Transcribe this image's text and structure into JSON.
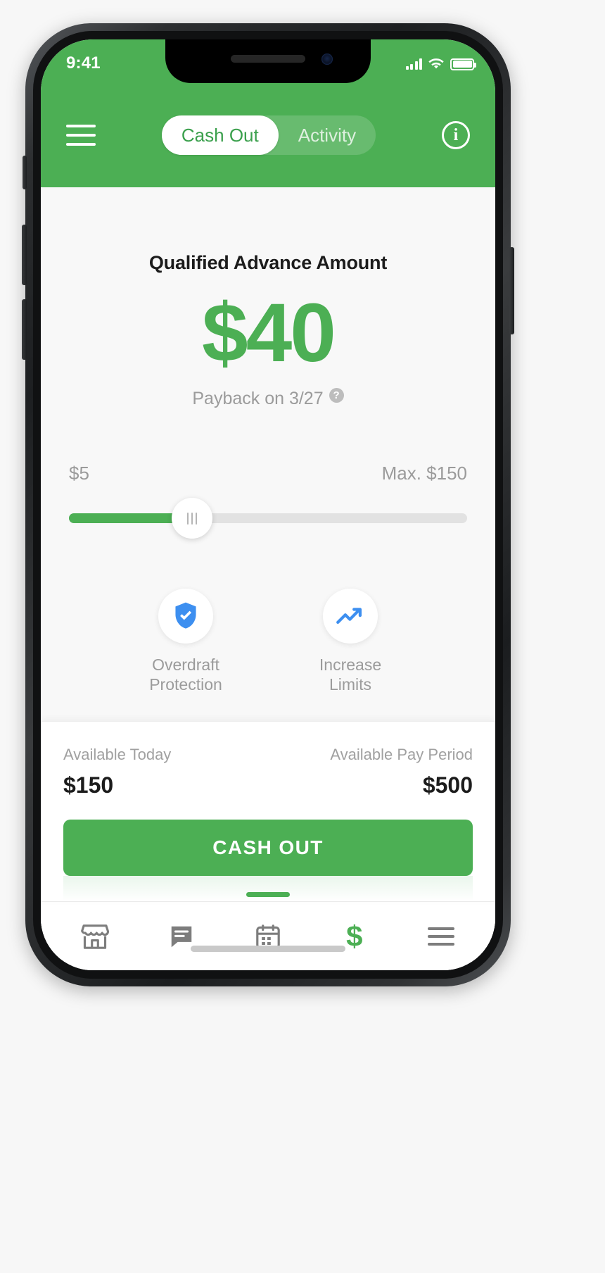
{
  "status_bar": {
    "time": "9:41",
    "icons": [
      "cellular-signal-icon",
      "wifi-icon",
      "battery-icon"
    ]
  },
  "header": {
    "menu_icon": "hamburger-menu-icon",
    "tabs": [
      {
        "label": "Cash Out",
        "active": true
      },
      {
        "label": "Activity",
        "active": false
      }
    ],
    "info_icon_label": "i"
  },
  "advance": {
    "title": "Qualified Advance Amount",
    "amount": "$40",
    "payback_text": "Payback on 3/27",
    "help_icon_label": "?"
  },
  "slider": {
    "min_label": "$5",
    "max_label": "Max. $150",
    "fill_percent": 31
  },
  "quick_actions": [
    {
      "icon": "shield-check-icon",
      "line1": "Overdraft",
      "line2": "Protection"
    },
    {
      "icon": "trending-up-icon",
      "line1": "Increase",
      "line2": "Limits"
    }
  ],
  "balances": {
    "today_label": "Available Today",
    "today_value": "$150",
    "period_label": "Available Pay Period",
    "period_value": "$500"
  },
  "cash_out_button": "CASH OUT",
  "tab_bar": [
    {
      "name": "store-icon"
    },
    {
      "name": "chat-icon"
    },
    {
      "name": "calendar-icon"
    },
    {
      "name": "dollar-icon",
      "label": "$",
      "active": true
    },
    {
      "name": "list-menu-icon"
    }
  ],
  "colors": {
    "brand_green": "#4caf54",
    "accent_blue": "#3d8ff0",
    "muted_gray": "#9b9b9b"
  }
}
